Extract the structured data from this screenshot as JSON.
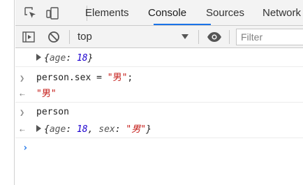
{
  "tabs": [
    {
      "label": "Elements"
    },
    {
      "label": "Console"
    },
    {
      "label": "Sources"
    },
    {
      "label": "Network"
    }
  ],
  "toolbar": {
    "context": "top",
    "filter_placeholder": "Filter"
  },
  "console": {
    "line1": {
      "open": "{",
      "key_age": "age",
      "colon": ": ",
      "age": "18",
      "close": "}"
    },
    "line2": {
      "code_pre": "person.sex = ",
      "code_str": "\"男\"",
      "code_post": ";"
    },
    "line3": {
      "result": "\"男\""
    },
    "line4": {
      "code": "person"
    },
    "line5": {
      "open": "{",
      "key_age": "age",
      "colon": ": ",
      "age": "18",
      "comma": ", ",
      "key_sex": "sex",
      "colon2": ": ",
      "sex": "\"男\"",
      "close": "}"
    }
  },
  "colors": {
    "accent": "#1a73e8",
    "number": "#1c00cf",
    "string": "#c41a16"
  },
  "icons": [
    "inspect-element-icon",
    "device-toolbar-icon",
    "sidebar-toggle-icon",
    "clear-console-icon",
    "dropdown-caret-icon",
    "eye-icon",
    "expand-triangle-icon",
    "input-chevron-icon",
    "result-arrow-icon",
    "prompt-icon"
  ]
}
